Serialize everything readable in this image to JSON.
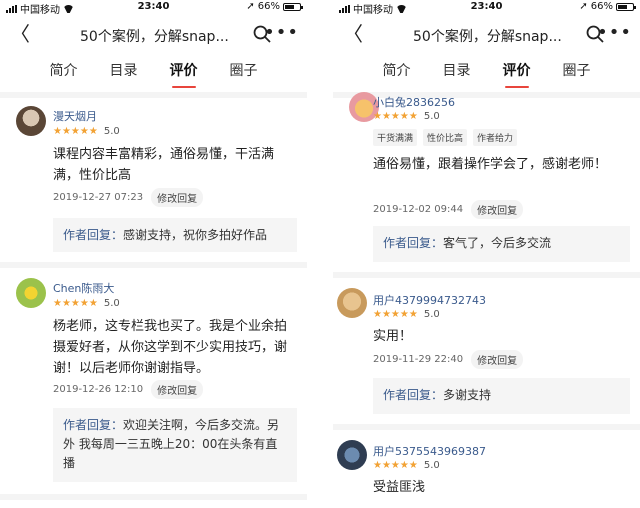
{
  "status": {
    "carrier": "中国移动",
    "time": "23:40",
    "battery": "66%",
    "battery_level": 0.66
  },
  "nav": {
    "title": "50个案例，分解snap...",
    "back_icon": "back-arrow-icon",
    "search_icon": "search-icon",
    "more_icon": "more-icon"
  },
  "tabs": [
    "简介",
    "目录",
    "评价",
    "圈子"
  ],
  "active_tab": 2,
  "left_reviews": [
    {
      "user": "漫天烟月",
      "stars": "★★★★★",
      "score": "5.0",
      "content": "课程内容丰富精彩，通俗易懂，干活满满，性价比高",
      "date": "2019-12-27 07:23",
      "edit": "修改回复",
      "reply_label": "作者回复：",
      "reply": "感谢支持，祝你多拍好作品"
    },
    {
      "user": "Chen陈雨大",
      "stars": "★★★★★",
      "score": "5.0",
      "content": "杨老师，这专栏我也买了。我是个业余拍摄爱好者，从你这学到不少实用技巧，谢谢！以后老师你谢谢指导。",
      "date": "2019-12-26 12:10",
      "edit": "修改回复",
      "reply_label": "作者回复：",
      "reply": "欢迎关注啊，今后多交流。另外 我每周一三五晚上20：00在头条有直播"
    }
  ],
  "right_reviews": [
    {
      "user": "小白兔2836256",
      "stars": "★★★★★",
      "score": "5.0",
      "tags": [
        "干货满满",
        "性价比高",
        "作者给力"
      ],
      "content": "通俗易懂，跟着操作学会了，感谢老师！",
      "date": "2019-12-02 09:44",
      "edit": "修改回复",
      "reply_label": "作者回复：",
      "reply": "客气了，今后多交流"
    },
    {
      "user": "用户4379994732743",
      "stars": "★★★★★",
      "score": "5.0",
      "content": "实用！",
      "date": "2019-11-29 22:40",
      "edit": "修改回复",
      "reply_label": "作者回复：",
      "reply": "多谢支持"
    },
    {
      "user": "用户5375543969387",
      "stars": "★★★★★",
      "score": "5.0",
      "content": "受益匪浅"
    }
  ]
}
